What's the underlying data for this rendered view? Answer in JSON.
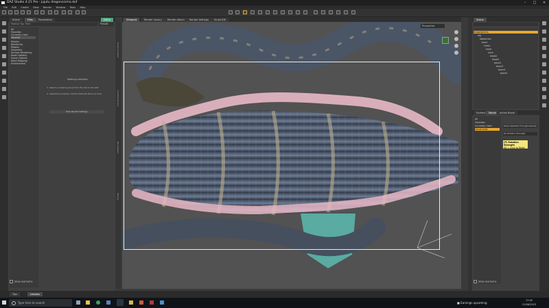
{
  "app": {
    "title": "DAZ Studio 4.21 Pro - jujutu dragonsnima.duf"
  },
  "menu": [
    "File",
    "Edit",
    "Create",
    "View",
    "Render",
    "Window",
    "Tools",
    "Help"
  ],
  "left_panel": {
    "tabs": [
      "Scene",
      "Files",
      "Parameters"
    ],
    "mode_tabs": [
      "Editor",
      "Presets"
    ],
    "filter_placeholder": "Positive Tag. Filter",
    "rows": [
      "All",
      "Favorites",
      "Currently Used",
      "General",
      "Morphs",
      "Rendering",
      "Display",
      "Geometry",
      "Surface Rendering",
      "Node Visibility",
      "Scene Objects",
      "Mesh Mapping",
      "Environment"
    ],
    "hint_title": "Nothing selected",
    "hint_lines": [
      "1. Select a property group from the list on the left.",
      "2. Adjust the property controls that will show up here."
    ],
    "bottom_button": "Hide Render Settings",
    "footer_chk": "Show Sub Items"
  },
  "viewport": {
    "tabs": [
      "Viewport",
      "Render Library",
      "Render Album",
      "Render Settings",
      "Script IDE"
    ],
    "camera": "Perspective"
  },
  "right_panel": {
    "top_tab": "Scene",
    "tree": [
      "dragonsnima",
      "hip",
      "lAbdomen",
      "bone",
      "chest",
      "head",
      "neck",
      "head2",
      "head3",
      "bone2",
      "bone3",
      "bone4",
      "bone5"
    ],
    "tabs": [
      "Surface",
      "Morph",
      "Action Brush"
    ],
    "list": [
      "All",
      "Favorites",
      "Currently Used",
      "Constraints"
    ],
    "tool_label": "Move Selected Through Density",
    "property": "(P) Rotation Strength",
    "tooltip_line2": "Alt + Click to Reset",
    "footer_chk": "Show Sub Items"
  },
  "bottom_tabs": [
    "Tips",
    "Lessons"
  ],
  "taskbar": {
    "search_placeholder": "Type here to search",
    "weather": "Earnings upcoming",
    "time": "17:05",
    "date": "21/06/2023"
  }
}
